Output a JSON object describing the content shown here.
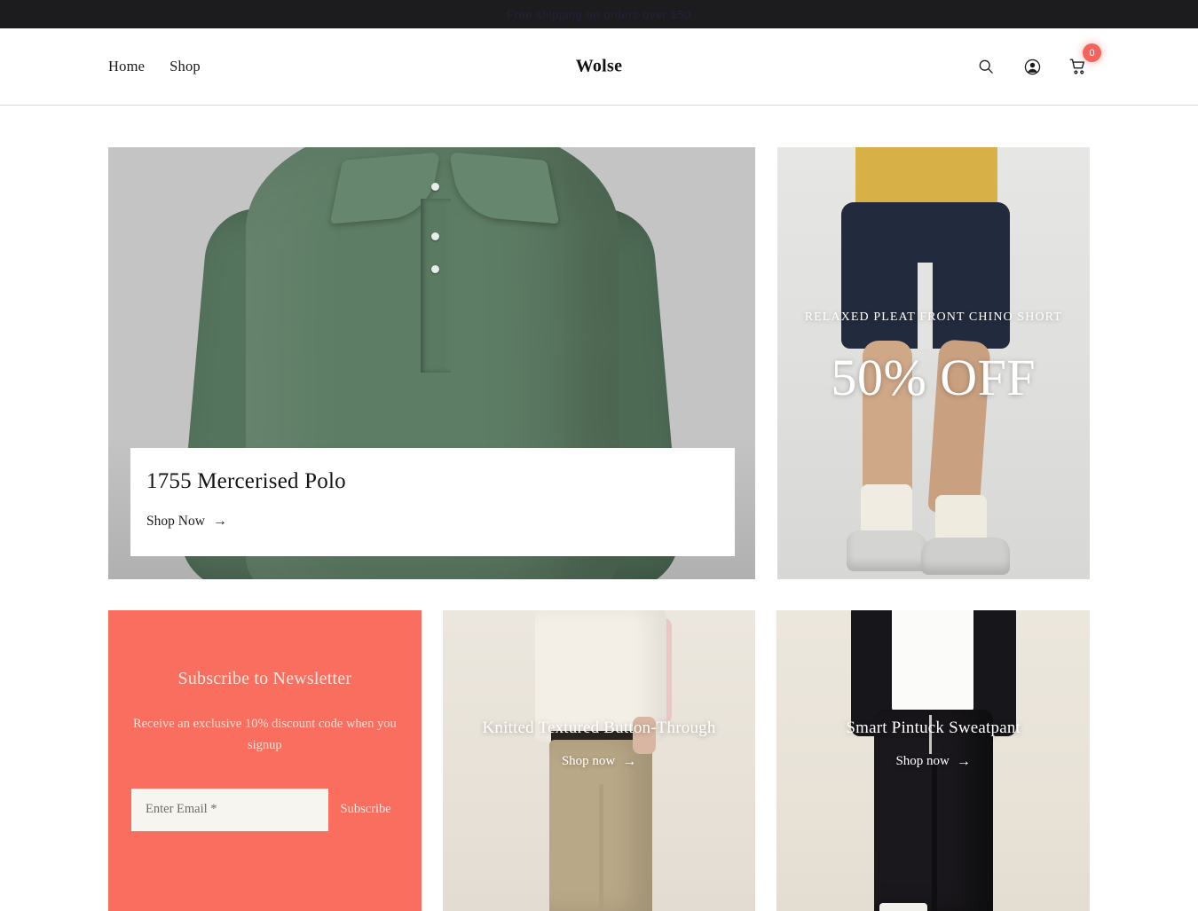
{
  "announcement": {
    "text": "Free shipping on orders over $50"
  },
  "header": {
    "brand": "Wolse",
    "nav": [
      {
        "label": "Home",
        "name": "nav-link-home"
      },
      {
        "label": "Shop",
        "name": "nav-link-shop"
      }
    ],
    "actions": {
      "search_icon": "search-icon",
      "account_icon": "account-icon",
      "cart_icon": "cart-icon",
      "cart_count": "0"
    }
  },
  "hero": {
    "title": "1755 Mercerised Polo",
    "cta": "Shop Now",
    "cta_arrow": "→"
  },
  "promo": {
    "kicker": "RELAXED PLEAT FRONT CHINO SHORT",
    "headline": "50% OFF"
  },
  "newsletter": {
    "title": "Subscribe to Newsletter",
    "subtitle": "Receive an exclusive 10% discount code when you signup",
    "email_placeholder": "Enter Email *",
    "email_value": "",
    "submit_label": "Subscribe",
    "background_color": "#fa6e5f"
  },
  "tiles": [
    {
      "title": "Knitted Textured Button-Through",
      "cta": "Shop now",
      "cta_arrow": "→"
    },
    {
      "title": "Smart Pintuck Sweatpant",
      "cta": "Shop now",
      "cta_arrow": "→"
    }
  ]
}
